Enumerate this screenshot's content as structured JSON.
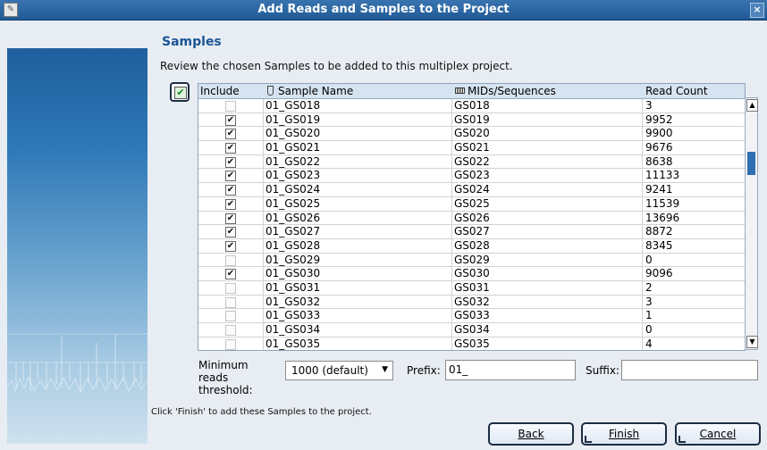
{
  "window": {
    "title": "Add Reads and Samples to the Project",
    "close_glyph": "×"
  },
  "page": {
    "heading": "Samples",
    "description": "Review the chosen Samples to be added to this multiplex project.",
    "footer_note": "Click 'Finish' to add these Samples to the project."
  },
  "table": {
    "header_include": "Include",
    "header_name": "Sample Name",
    "header_mid": "MIDs/Sequences",
    "header_count": "Read Count",
    "rows": [
      {
        "include": false,
        "name": "01_GS018",
        "mid": "GS018",
        "count": "3"
      },
      {
        "include": true,
        "name": "01_GS019",
        "mid": "GS019",
        "count": "9952"
      },
      {
        "include": true,
        "name": "01_GS020",
        "mid": "GS020",
        "count": "9900"
      },
      {
        "include": true,
        "name": "01_GS021",
        "mid": "GS021",
        "count": "9676"
      },
      {
        "include": true,
        "name": "01_GS022",
        "mid": "GS022",
        "count": "8638"
      },
      {
        "include": true,
        "name": "01_GS023",
        "mid": "GS023",
        "count": "11133"
      },
      {
        "include": true,
        "name": "01_GS024",
        "mid": "GS024",
        "count": "9241"
      },
      {
        "include": true,
        "name": "01_GS025",
        "mid": "GS025",
        "count": "11539"
      },
      {
        "include": true,
        "name": "01_GS026",
        "mid": "GS026",
        "count": "13696"
      },
      {
        "include": true,
        "name": "01_GS027",
        "mid": "GS027",
        "count": "8872"
      },
      {
        "include": true,
        "name": "01_GS028",
        "mid": "GS028",
        "count": "8345"
      },
      {
        "include": false,
        "name": "01_GS029",
        "mid": "GS029",
        "count": "0"
      },
      {
        "include": true,
        "name": "01_GS030",
        "mid": "GS030",
        "count": "9096"
      },
      {
        "include": false,
        "name": "01_GS031",
        "mid": "GS031",
        "count": "2"
      },
      {
        "include": false,
        "name": "01_GS032",
        "mid": "GS032",
        "count": "3"
      },
      {
        "include": false,
        "name": "01_GS033",
        "mid": "GS033",
        "count": "1"
      },
      {
        "include": false,
        "name": "01_GS034",
        "mid": "GS034",
        "count": "0"
      },
      {
        "include": false,
        "name": "01_GS035",
        "mid": "GS035",
        "count": "4"
      }
    ]
  },
  "controls": {
    "min_reads_label": "Minimum reads threshold:",
    "min_reads_value": "1000 (default)",
    "prefix_label": "Prefix:",
    "prefix_value": "01_",
    "suffix_label": "Suffix:",
    "suffix_value": ""
  },
  "buttons": {
    "back": "Back",
    "finish": "Finish",
    "cancel": "Cancel"
  },
  "icons": {
    "checkmark": "✔",
    "up": "▲",
    "down": "▼",
    "dropdown": "▼"
  }
}
